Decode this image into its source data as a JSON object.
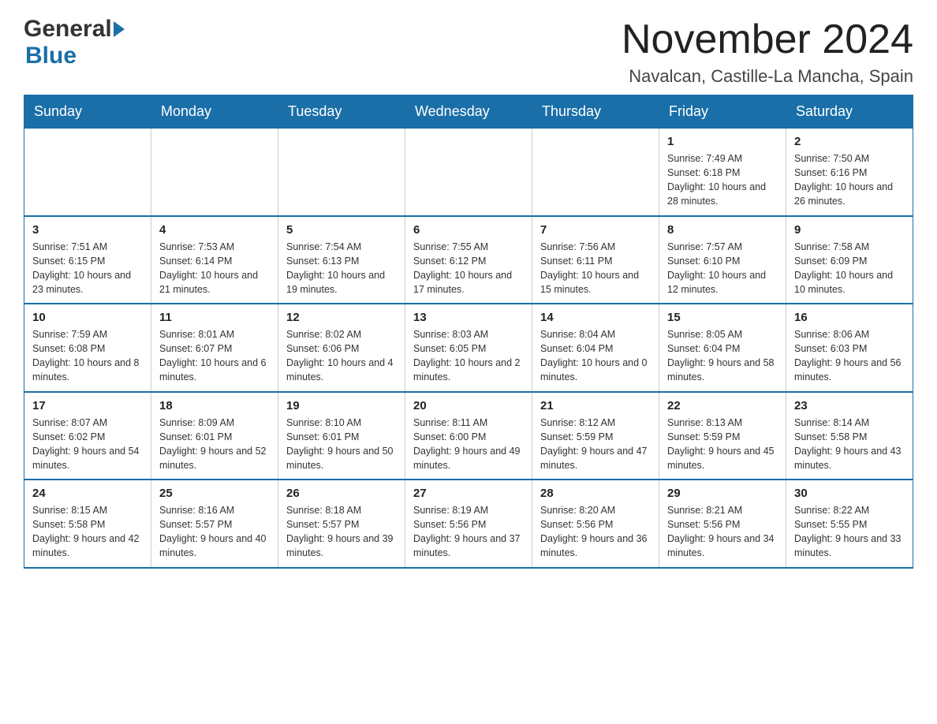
{
  "header": {
    "logo_general": "General",
    "logo_blue": "Blue",
    "title": "November 2024",
    "subtitle": "Navalcan, Castille-La Mancha, Spain"
  },
  "weekdays": [
    "Sunday",
    "Monday",
    "Tuesday",
    "Wednesday",
    "Thursday",
    "Friday",
    "Saturday"
  ],
  "weeks": [
    [
      {
        "day": "",
        "info": ""
      },
      {
        "day": "",
        "info": ""
      },
      {
        "day": "",
        "info": ""
      },
      {
        "day": "",
        "info": ""
      },
      {
        "day": "",
        "info": ""
      },
      {
        "day": "1",
        "info": "Sunrise: 7:49 AM\nSunset: 6:18 PM\nDaylight: 10 hours and 28 minutes."
      },
      {
        "day": "2",
        "info": "Sunrise: 7:50 AM\nSunset: 6:16 PM\nDaylight: 10 hours and 26 minutes."
      }
    ],
    [
      {
        "day": "3",
        "info": "Sunrise: 7:51 AM\nSunset: 6:15 PM\nDaylight: 10 hours and 23 minutes."
      },
      {
        "day": "4",
        "info": "Sunrise: 7:53 AM\nSunset: 6:14 PM\nDaylight: 10 hours and 21 minutes."
      },
      {
        "day": "5",
        "info": "Sunrise: 7:54 AM\nSunset: 6:13 PM\nDaylight: 10 hours and 19 minutes."
      },
      {
        "day": "6",
        "info": "Sunrise: 7:55 AM\nSunset: 6:12 PM\nDaylight: 10 hours and 17 minutes."
      },
      {
        "day": "7",
        "info": "Sunrise: 7:56 AM\nSunset: 6:11 PM\nDaylight: 10 hours and 15 minutes."
      },
      {
        "day": "8",
        "info": "Sunrise: 7:57 AM\nSunset: 6:10 PM\nDaylight: 10 hours and 12 minutes."
      },
      {
        "day": "9",
        "info": "Sunrise: 7:58 AM\nSunset: 6:09 PM\nDaylight: 10 hours and 10 minutes."
      }
    ],
    [
      {
        "day": "10",
        "info": "Sunrise: 7:59 AM\nSunset: 6:08 PM\nDaylight: 10 hours and 8 minutes."
      },
      {
        "day": "11",
        "info": "Sunrise: 8:01 AM\nSunset: 6:07 PM\nDaylight: 10 hours and 6 minutes."
      },
      {
        "day": "12",
        "info": "Sunrise: 8:02 AM\nSunset: 6:06 PM\nDaylight: 10 hours and 4 minutes."
      },
      {
        "day": "13",
        "info": "Sunrise: 8:03 AM\nSunset: 6:05 PM\nDaylight: 10 hours and 2 minutes."
      },
      {
        "day": "14",
        "info": "Sunrise: 8:04 AM\nSunset: 6:04 PM\nDaylight: 10 hours and 0 minutes."
      },
      {
        "day": "15",
        "info": "Sunrise: 8:05 AM\nSunset: 6:04 PM\nDaylight: 9 hours and 58 minutes."
      },
      {
        "day": "16",
        "info": "Sunrise: 8:06 AM\nSunset: 6:03 PM\nDaylight: 9 hours and 56 minutes."
      }
    ],
    [
      {
        "day": "17",
        "info": "Sunrise: 8:07 AM\nSunset: 6:02 PM\nDaylight: 9 hours and 54 minutes."
      },
      {
        "day": "18",
        "info": "Sunrise: 8:09 AM\nSunset: 6:01 PM\nDaylight: 9 hours and 52 minutes."
      },
      {
        "day": "19",
        "info": "Sunrise: 8:10 AM\nSunset: 6:01 PM\nDaylight: 9 hours and 50 minutes."
      },
      {
        "day": "20",
        "info": "Sunrise: 8:11 AM\nSunset: 6:00 PM\nDaylight: 9 hours and 49 minutes."
      },
      {
        "day": "21",
        "info": "Sunrise: 8:12 AM\nSunset: 5:59 PM\nDaylight: 9 hours and 47 minutes."
      },
      {
        "day": "22",
        "info": "Sunrise: 8:13 AM\nSunset: 5:59 PM\nDaylight: 9 hours and 45 minutes."
      },
      {
        "day": "23",
        "info": "Sunrise: 8:14 AM\nSunset: 5:58 PM\nDaylight: 9 hours and 43 minutes."
      }
    ],
    [
      {
        "day": "24",
        "info": "Sunrise: 8:15 AM\nSunset: 5:58 PM\nDaylight: 9 hours and 42 minutes."
      },
      {
        "day": "25",
        "info": "Sunrise: 8:16 AM\nSunset: 5:57 PM\nDaylight: 9 hours and 40 minutes."
      },
      {
        "day": "26",
        "info": "Sunrise: 8:18 AM\nSunset: 5:57 PM\nDaylight: 9 hours and 39 minutes."
      },
      {
        "day": "27",
        "info": "Sunrise: 8:19 AM\nSunset: 5:56 PM\nDaylight: 9 hours and 37 minutes."
      },
      {
        "day": "28",
        "info": "Sunrise: 8:20 AM\nSunset: 5:56 PM\nDaylight: 9 hours and 36 minutes."
      },
      {
        "day": "29",
        "info": "Sunrise: 8:21 AM\nSunset: 5:56 PM\nDaylight: 9 hours and 34 minutes."
      },
      {
        "day": "30",
        "info": "Sunrise: 8:22 AM\nSunset: 5:55 PM\nDaylight: 9 hours and 33 minutes."
      }
    ]
  ]
}
